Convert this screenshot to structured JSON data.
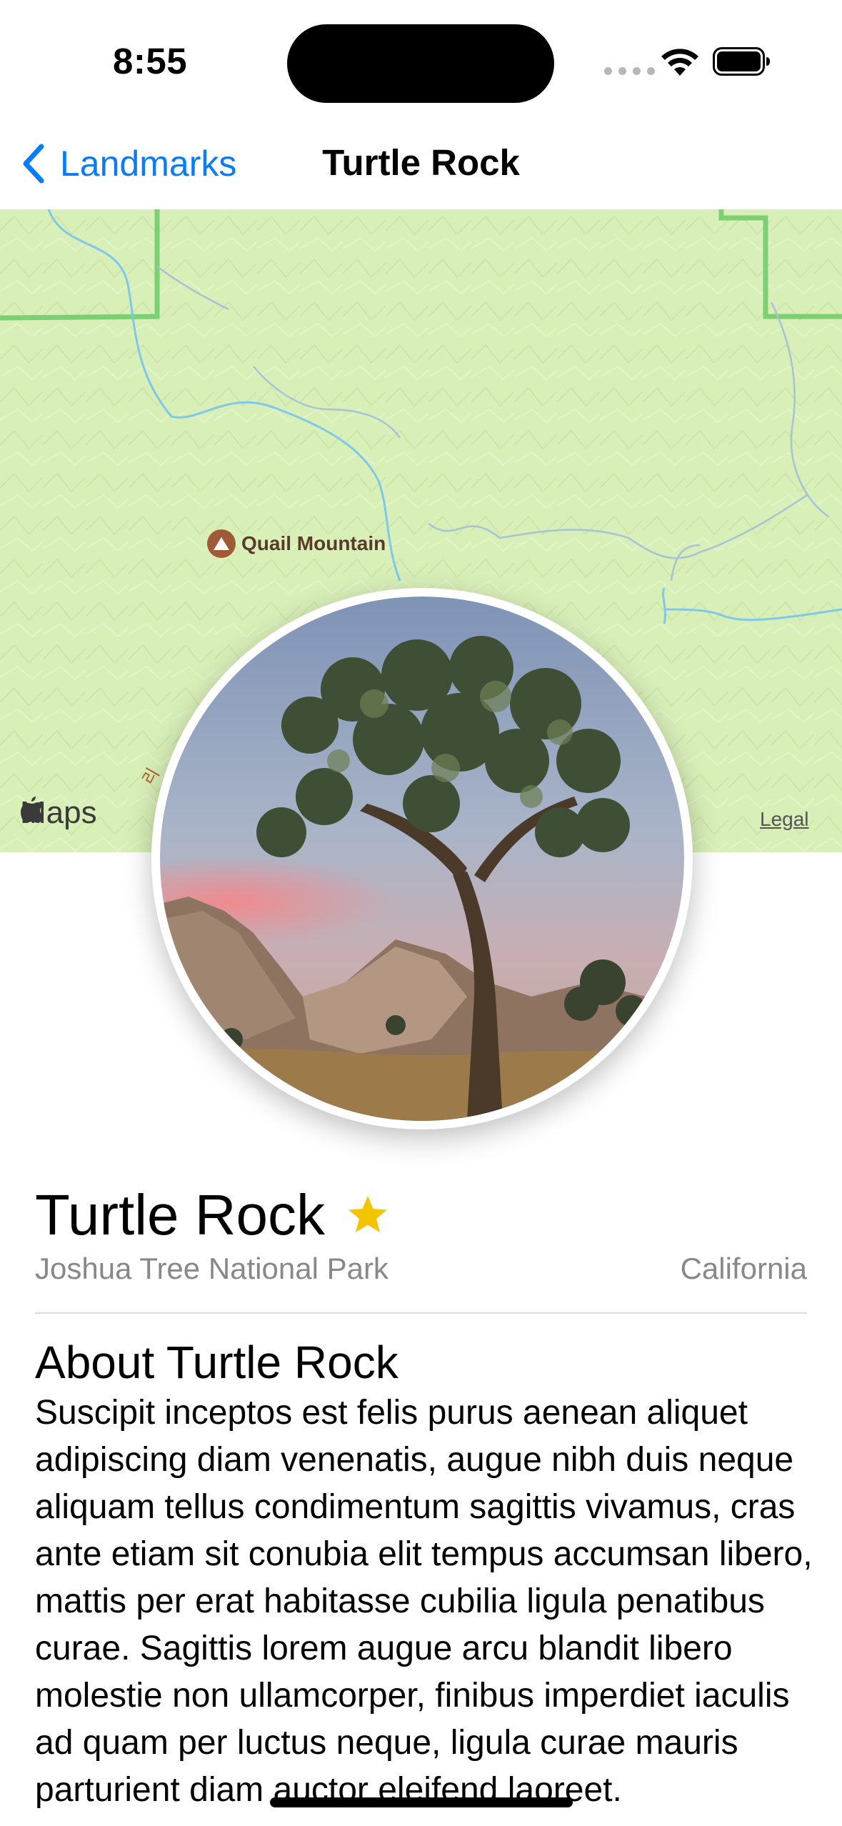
{
  "status_bar": {
    "time": "8:55"
  },
  "nav": {
    "back_label": "Landmarks",
    "title": "Turtle Rock"
  },
  "map": {
    "poi_label": "Quail Mountain",
    "logo": "Maps",
    "legal": "Legal",
    "road_label": "리"
  },
  "landmark": {
    "name": "Turtle Rock",
    "favorite": true,
    "park": "Joshua Tree National Park",
    "state": "California",
    "about_title": "About Turtle Rock",
    "about_text": "Suscipit inceptos est felis purus aenean aliquet adipiscing diam venenatis, augue nibh duis neque aliquam tellus condimentum sagittis vivamus, cras ante etiam sit conubia elit tempus accumsan libero, mattis per erat habitasse cubilia ligula penatibus curae. Sagittis lorem augue arcu blandit libero molestie non ullamcorper, finibus imperdiet iaculis ad quam per luctus neque, ligula curae mauris parturient diam auctor eleifend laoreet."
  },
  "colors": {
    "accent": "#0a7cf7",
    "star": "#f5c400",
    "map_bg": "#d9efb8",
    "secondary_text": "#888888"
  },
  "icons": [
    "chevron-left-icon",
    "wifi-icon",
    "battery-icon",
    "mountain-icon",
    "apple-logo-icon",
    "star-icon"
  ]
}
